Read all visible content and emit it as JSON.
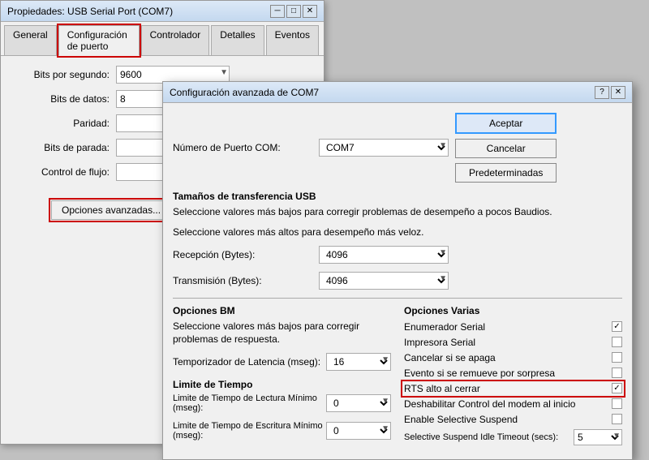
{
  "props_window": {
    "title": "Propiedades: USB Serial Port (COM7)",
    "tabs": [
      {
        "id": "general",
        "label": "General"
      },
      {
        "id": "config",
        "label": "Configuración de puerto",
        "active": true
      },
      {
        "id": "driver",
        "label": "Controlador"
      },
      {
        "id": "details",
        "label": "Detalles"
      },
      {
        "id": "events",
        "label": "Eventos"
      }
    ],
    "fields": [
      {
        "label": "Bits por segundo:",
        "value": "9600"
      },
      {
        "label": "Bits de datos:",
        "value": "8"
      },
      {
        "label": "Paridad:",
        "value": ""
      },
      {
        "label": "Bits de parada:",
        "value": ""
      },
      {
        "label": "Control de flujo:",
        "value": ""
      }
    ],
    "adv_button": "Opciones avanzadas..."
  },
  "adv_dialog": {
    "title": "Configuración avanzada de COM7",
    "help_icon": "?",
    "close_icon": "✕",
    "port_label": "Número de Puerto COM:",
    "port_value": "COM7",
    "usb_section": "Tamaños de transferencia USB",
    "usb_desc_low": "Seleccione valores más bajos para corregir problemas de desempeño a pocos Baudios.",
    "usb_desc_high": "Seleccione valores más altos para desempeño más veloz.",
    "receive_label": "Recepción (Bytes):",
    "receive_value": "4096",
    "transmit_label": "Transmisión (Bytes):",
    "transmit_value": "4096",
    "options_bm_title": "Opciones BM",
    "options_bm_desc": "Seleccione valores más bajos para corregir problemas de respuesta.",
    "latency_label": "Temporizador de Latencia (mseg):",
    "latency_value": "16",
    "time_limit_label": "Limite de Tiempo",
    "read_limit_label": "Limite de Tiempo de Lectura Mínimo (mseg):",
    "read_limit_value": "0",
    "write_limit_label": "Limite de Tiempo de Escritura Mínimo (mseg):",
    "write_limit_value": "0",
    "options_varias_title": "Opciones Varias",
    "check_items": [
      {
        "label": "Enumerador Serial",
        "checked": true
      },
      {
        "label": "Impresora Serial",
        "checked": false
      },
      {
        "label": "Cancelar si se apaga",
        "checked": false
      },
      {
        "label": "Evento si se remueve por sorpresa",
        "checked": false
      },
      {
        "label": "RTS alto al cerrar",
        "checked": true,
        "highlighted": true
      },
      {
        "label": "Deshabilitar Control del modem al inicio",
        "checked": false
      },
      {
        "label": "Enable Selective Suspend",
        "checked": false
      }
    ],
    "selective_suspend_timeout_label": "Selective Suspend Idle Timeout (secs):",
    "selective_suspend_timeout_value": "5",
    "btn_accept": "Aceptar",
    "btn_cancel": "Cancelar",
    "btn_defaults": "Predeterminadas",
    "select_options_4096": [
      "4096"
    ],
    "select_options_16": [
      "16"
    ],
    "select_options_0": [
      "0"
    ],
    "select_options_com7": [
      "COM7"
    ],
    "select_options_5": [
      "5"
    ]
  },
  "titlebar_controls": {
    "minimize": "─",
    "maximize": "□",
    "close": "✕"
  }
}
